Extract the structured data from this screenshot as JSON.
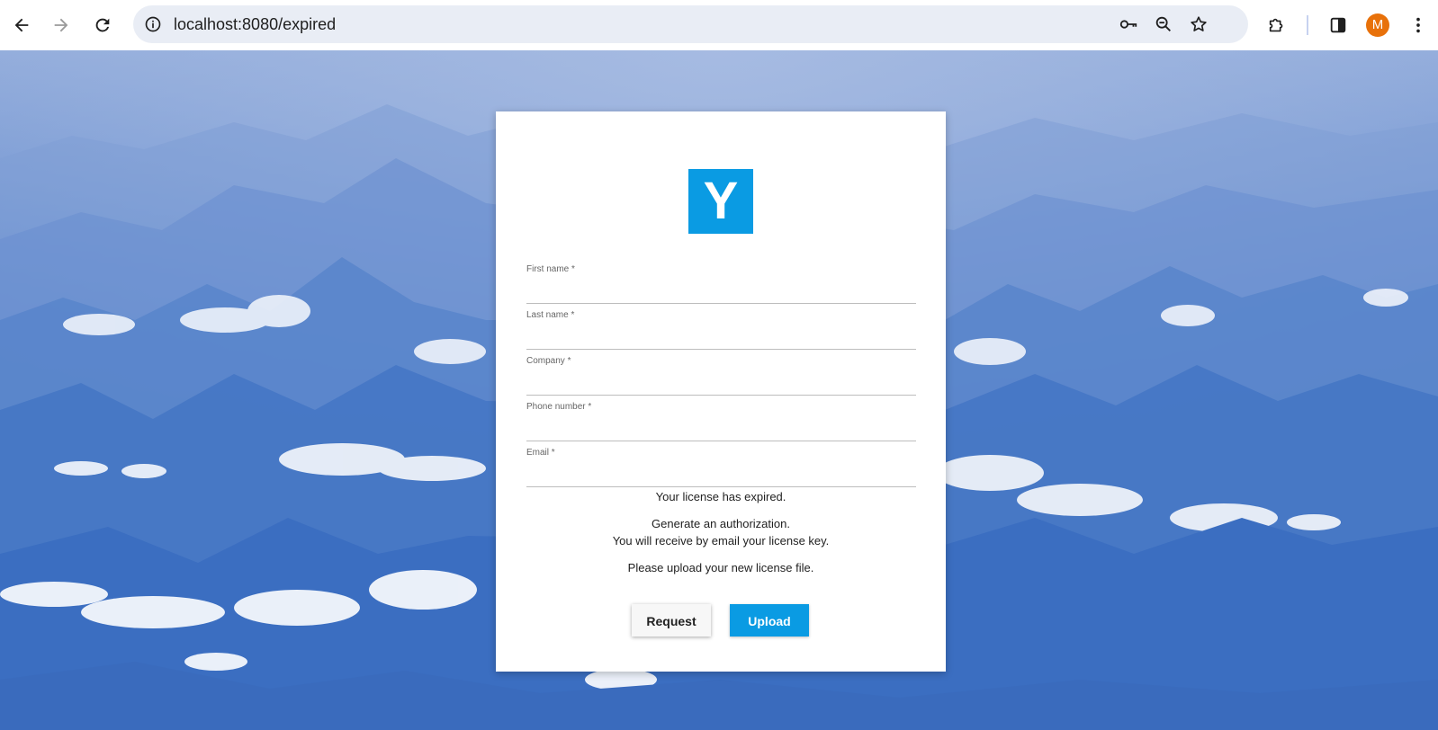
{
  "browser": {
    "url": "localhost:8080/expired",
    "profile_initial": "M",
    "profile_color": "#e8710a",
    "icons": {
      "back": "back-arrow-icon",
      "forward": "forward-arrow-icon",
      "reload": "reload-icon",
      "site_info": "info-icon",
      "password": "key-icon",
      "zoom": "zoom-out-icon",
      "bookmark": "star-icon",
      "extensions": "puzzle-icon",
      "side_panel": "side-panel-icon",
      "menu": "kebab-menu-icon"
    }
  },
  "page": {
    "logo_letter": "Y",
    "logo_color": "#0a9be3",
    "form": {
      "fields": [
        {
          "label": "First name *",
          "value": ""
        },
        {
          "label": "Last name *",
          "value": ""
        },
        {
          "label": "Company *",
          "value": ""
        },
        {
          "label": "Phone number *",
          "value": ""
        },
        {
          "label": "Email *",
          "value": ""
        }
      ]
    },
    "messages": {
      "expired": "Your license has expired.",
      "generate": "Generate an authorization.",
      "receive": "You will receive by email your license key.",
      "upload": "Please upload your new license file."
    },
    "buttons": {
      "request": "Request",
      "upload": "Upload"
    }
  }
}
